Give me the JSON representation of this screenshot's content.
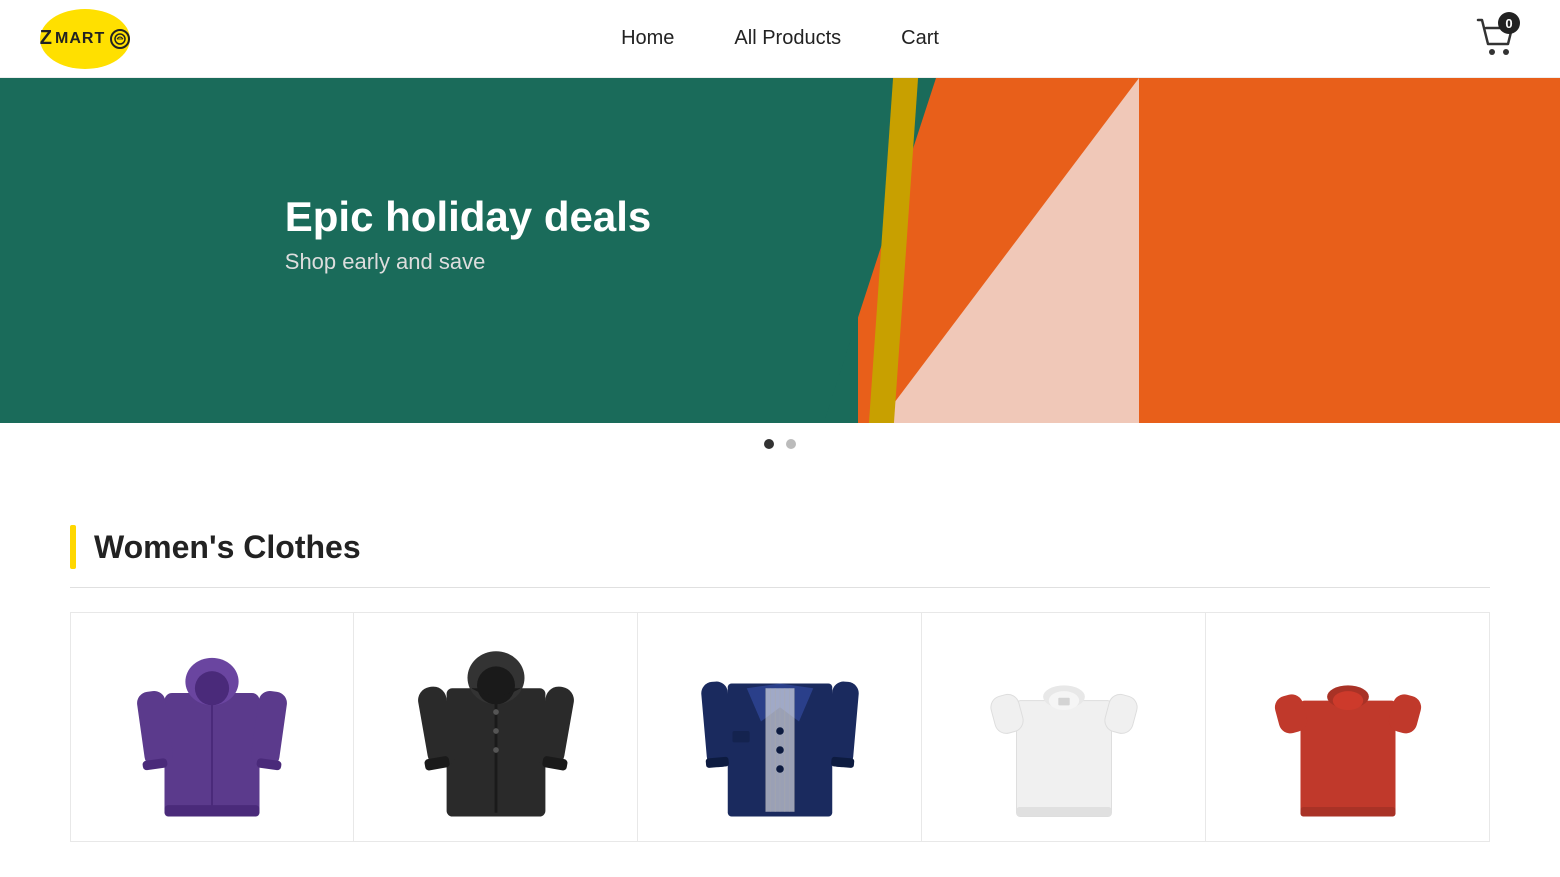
{
  "header": {
    "logo_text": "Z MART",
    "logo_z": "Z",
    "logo_mart": "MART",
    "nav": {
      "home": "Home",
      "all_products": "All Products",
      "cart": "Cart"
    },
    "cart_badge": "0"
  },
  "banner": {
    "title": "Epic holiday deals",
    "subtitle": "Shop early and save",
    "slides": [
      1,
      2
    ],
    "active_slide": 0
  },
  "sections": [
    {
      "id": "womens-clothes",
      "title": "Women's Clothes",
      "products": [
        {
          "id": 1,
          "name": "Purple Hooded Jacket",
          "color": "purple",
          "type": "jacket"
        },
        {
          "id": 2,
          "name": "Black Leather Jacket",
          "color": "black",
          "type": "jacket"
        },
        {
          "id": 3,
          "name": "Navy Blue Blazer",
          "color": "navy",
          "type": "jacket"
        },
        {
          "id": 4,
          "name": "White T-Shirt",
          "color": "white",
          "type": "tshirt"
        },
        {
          "id": 5,
          "name": "Red T-Shirt",
          "color": "red",
          "type": "tshirt"
        }
      ]
    }
  ]
}
